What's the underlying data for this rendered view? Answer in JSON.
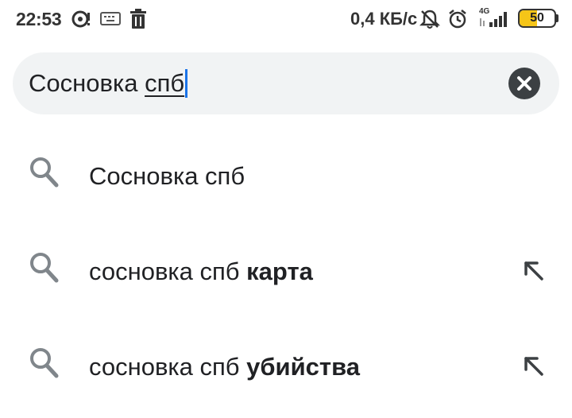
{
  "status_bar": {
    "time": "22:53",
    "network_speed": "0,4 КБ/с",
    "network_type": "4G",
    "battery_level": "50",
    "icons": [
      "sync-icon",
      "keyboard-icon",
      "trash-icon",
      "notifications-muted-icon",
      "alarm-icon",
      "signal-icon",
      "battery-icon"
    ]
  },
  "search": {
    "query_prefix": "Сосновка ",
    "query_underlined": "спб",
    "clear_icon": "clear-icon"
  },
  "suggestions": [
    {
      "text": "Сосновка спб",
      "bold": "",
      "icon": "search-icon",
      "action_icon": ""
    },
    {
      "text": "сосновка спб ",
      "bold": "карта",
      "icon": "search-icon",
      "action_icon": "arrow-up-left-icon"
    },
    {
      "text": "сосновка спб ",
      "bold": "убийства",
      "icon": "search-icon",
      "action_icon": "arrow-up-left-icon"
    }
  ],
  "colors": {
    "search_bg": "#f1f3f4",
    "caret": "#1a73e8",
    "icon_gray": "#80868b",
    "battery_fill": "#f5c518"
  }
}
